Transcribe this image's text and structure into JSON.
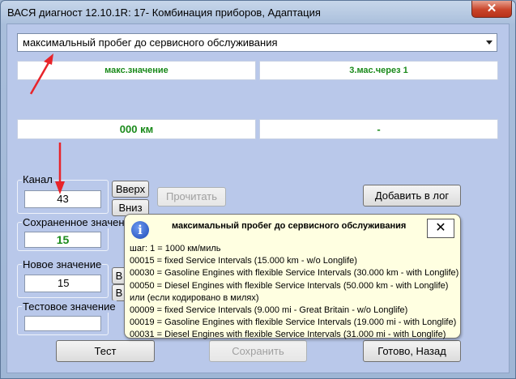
{
  "window": {
    "title": "ВАСЯ диагност 12.10.1R: 17- Комбинация приборов, Адаптация",
    "close_glyph": "✕"
  },
  "adaptation_select": {
    "value": "максимальный пробег до сервисного обслуживания"
  },
  "header_panels": {
    "left": "макс.значение",
    "right": "3.мас.через 1"
  },
  "value_panels": {
    "left": "000 км",
    "right": "-"
  },
  "channel": {
    "label": "Канал",
    "value": "43",
    "up_button": "Вверх",
    "down_button": "Вниз"
  },
  "buttons": {
    "read": "Прочитать",
    "add_to_log": "Добавить в лог",
    "test": "Тест",
    "save": "Сохранить",
    "done": "Готово, Назад",
    "new_value_hidden_1": "В",
    "new_value_hidden_2": "В"
  },
  "saved_value": {
    "label": "Сохраненное значение",
    "value": "15"
  },
  "new_value": {
    "label": "Новое значение",
    "value": "15"
  },
  "test_value": {
    "label": "Тестовое значение",
    "value": ""
  },
  "tooltip": {
    "icon": "i",
    "title": "максимальный пробег до сервисного обслуживания",
    "close_glyph": "✕",
    "lines": [
      "шаг: 1 = 1000 км/миль",
      "00015 = fixed Service Intervals (15.000 km - w/o Longlife)",
      "00030 = Gasoline Engines with flexible Service Intervals (30.000 km - with Longlife)",
      "00050 = Diesel Engines with flexible Service Intervals (50.000 km - with Longlife)",
      "или (если кодировано в милях)",
      "00009 = fixed Service Intervals (9.000 mi - Great Britain - w/o Longlife)",
      "00019 = Gasoline Engines with flexible Service Intervals (19.000 mi - with Longlife)",
      "00031 = Diesel Engines with flexible Service Intervals (31.000 mi - with Longlife)"
    ]
  },
  "colors": {
    "annotation_arrow": "#e8242a",
    "value_text": "#1a8a1a"
  }
}
